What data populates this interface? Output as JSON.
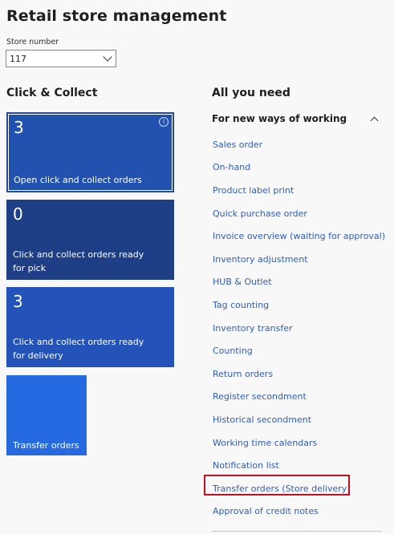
{
  "header": {
    "title": "Retail store management"
  },
  "store": {
    "label": "Store number",
    "value": "117"
  },
  "click_collect": {
    "title": "Click & Collect",
    "tiles": [
      {
        "count": "3",
        "label": "Open click and collect orders",
        "color": "#2152b0",
        "info_icon": "info-icon"
      },
      {
        "count": "0",
        "label": "Click and collect orders ready for pick",
        "color": "#1e3f85"
      },
      {
        "count": "3",
        "label": "Click and collect orders ready for delivery",
        "color": "#2352b8"
      },
      {
        "count": "",
        "label": "Transfer orders",
        "color": "#256ae0"
      }
    ]
  },
  "all_you_need": {
    "title": "All you need",
    "group": {
      "title": "For new ways of working",
      "icon": "chevron-up-icon"
    },
    "links": [
      "Sales order",
      "On-hand",
      "Product label print",
      "Quick purchase order",
      "Invoice overview (waiting for approval)",
      "Inventory adjustment",
      "HUB & Outlet",
      "Tag counting",
      "Inventory transfer",
      "Counting",
      "Return orders",
      "Register secondment",
      "Historical secondment",
      "Working time calendars",
      "Notification list",
      "Transfer orders (Store delivery)",
      "Approval of credit notes"
    ],
    "highlighted_link": "Transfer orders (Store delivery)",
    "highlight_color": "#c50f1f",
    "link_color": "#2f5eb8"
  }
}
